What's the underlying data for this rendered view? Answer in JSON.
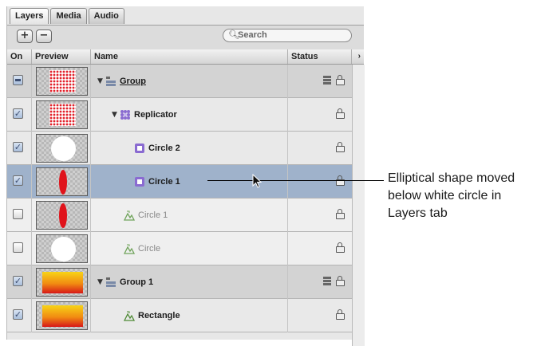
{
  "tabs": [
    {
      "label": "Layers",
      "active": true
    },
    {
      "label": "Media",
      "active": false
    },
    {
      "label": "Audio",
      "active": false
    }
  ],
  "toolbar": {
    "add_label": "+",
    "remove_label": "−",
    "search_placeholder": "Search"
  },
  "columns": {
    "on": "On",
    "preview": "Preview",
    "name": "Name",
    "status": "Status",
    "expand": "›"
  },
  "rows": [
    {
      "name": "Group",
      "checked": "mixed",
      "preview": "dots",
      "kind": "group",
      "icon": "group-icon",
      "expanded": true
    },
    {
      "name": "Replicator",
      "checked": true,
      "preview": "dots",
      "kind": "replicator",
      "icon": "replicator-icon",
      "expanded": true
    },
    {
      "name": "Circle 2",
      "checked": true,
      "preview": "white-circle",
      "kind": "cell",
      "icon": "cell-icon"
    },
    {
      "name": "Circle 1",
      "checked": true,
      "preview": "red-ellipse",
      "kind": "cell",
      "icon": "cell-icon",
      "selected": true
    },
    {
      "name": "Circle 1",
      "checked": false,
      "preview": "red-ellipse",
      "kind": "shape",
      "icon": "shape-icon"
    },
    {
      "name": "Circle",
      "checked": false,
      "preview": "white-circle",
      "kind": "shape",
      "icon": "shape-icon"
    },
    {
      "name": "Group 1",
      "checked": true,
      "preview": "gradient-rect",
      "kind": "group",
      "icon": "group-icon",
      "expanded": true
    },
    {
      "name": "Rectangle",
      "checked": true,
      "preview": "gradient-rect",
      "kind": "shape",
      "icon": "shape-icon"
    }
  ],
  "callout": {
    "text": "Elliptical shape moved below white circle in Layers tab"
  },
  "colors": {
    "selected_row": "#9fb2cb",
    "red": "#e0131b",
    "gradient_top": "#f7d417",
    "gradient_bottom": "#d71818"
  }
}
